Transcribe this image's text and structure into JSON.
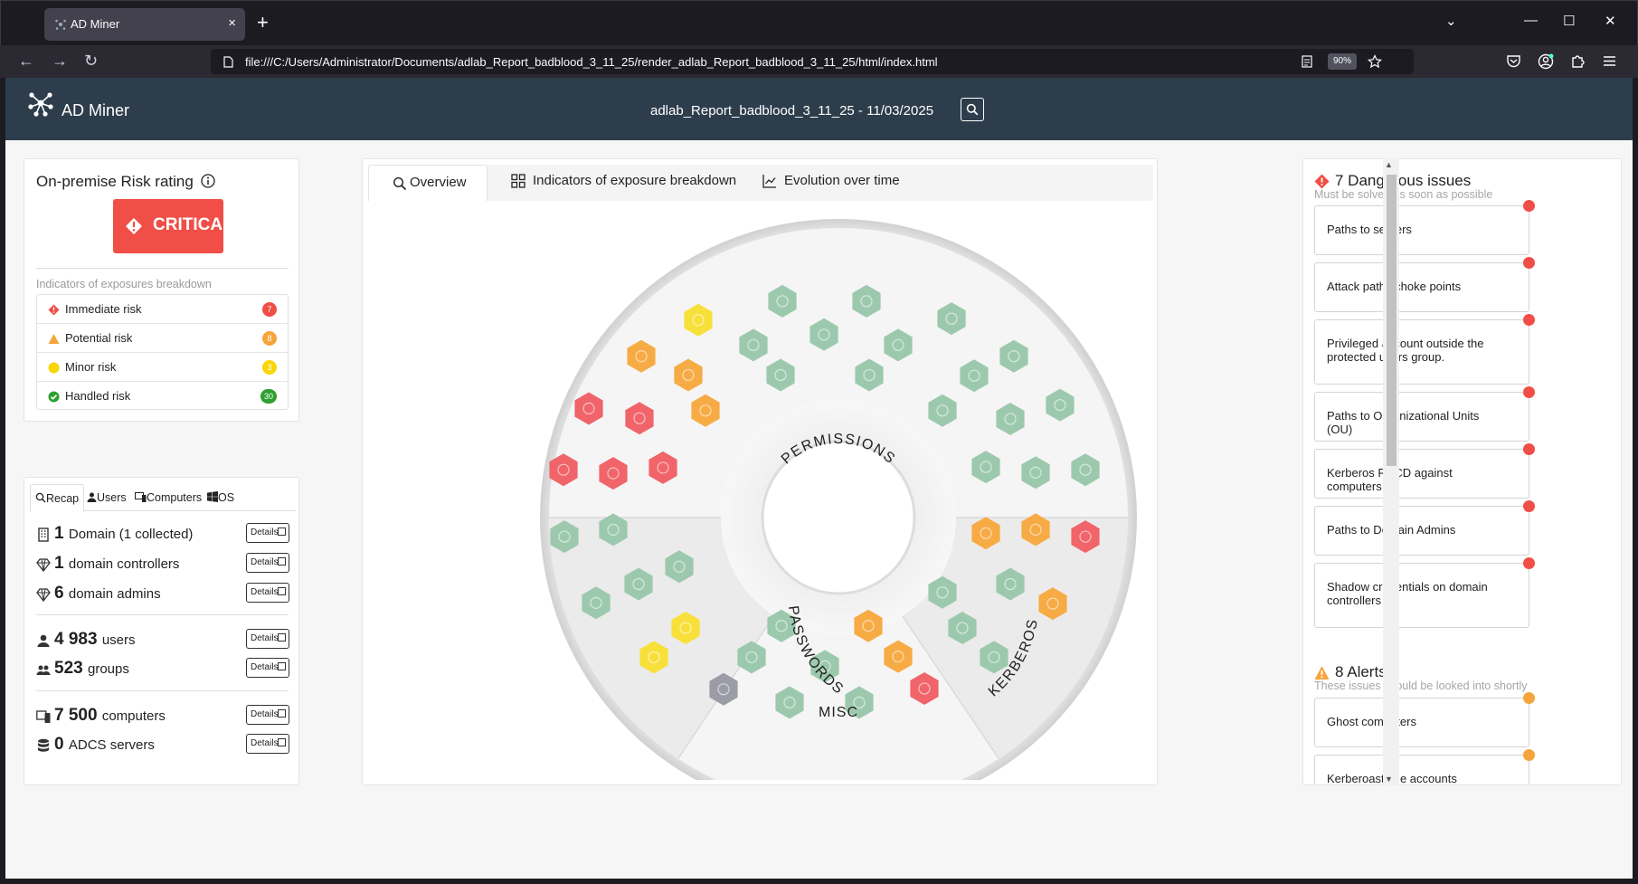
{
  "browser": {
    "tab_title": "AD Miner",
    "tab_close": "×",
    "new_tab": "+",
    "url": "file:///C:/Users/Administrator/Documents/adlab_Report_badblood_3_11_25/render_adlab_Report_badblood_3_11_25/html/index.html",
    "zoom": "90%",
    "controls": {
      "list": "⌄",
      "minimize": "—",
      "maximize": "☐",
      "close": "✕"
    },
    "nav": {
      "back": "←",
      "forward": "→",
      "reload": "↻"
    }
  },
  "header": {
    "brand": "AD Miner",
    "report_title": "adlab_Report_badblood_3_11_25 - 11/03/2025"
  },
  "risk": {
    "title": "On-premise Risk rating",
    "rating": "CRITICAL",
    "rating_color": "#f04e47",
    "indicators_title": "Indicators of exposures breakdown",
    "indicators": [
      {
        "label": "Immediate risk",
        "count": "7",
        "color": "#f04e47",
        "icon": "red-diamond-icon"
      },
      {
        "label": "Potential risk",
        "count": "8",
        "color": "#f5a53c",
        "icon": "orange-triangle-icon"
      },
      {
        "label": "Minor risk",
        "count": "3",
        "color": "#fad50a",
        "icon": "yellow-circle-icon"
      },
      {
        "label": "Handled risk",
        "count": "30",
        "color": "#2fa02f",
        "icon": "green-check-icon"
      }
    ]
  },
  "recap": {
    "tabs": [
      "Recap",
      "Users",
      "Computers",
      "OS"
    ],
    "details_label": "Details",
    "stats": [
      {
        "num": "1",
        "label": "Domain (1 collected)",
        "icon": "building-icon"
      },
      {
        "num": "1",
        "label": "domain controllers",
        "icon": "gem-icon"
      },
      {
        "num": "6",
        "label": "domain admins",
        "icon": "gem-icon"
      },
      {
        "num": "4 983",
        "label": "users",
        "icon": "user-icon"
      },
      {
        "num": "523",
        "label": "groups",
        "icon": "users-icon"
      },
      {
        "num": "7 500",
        "label": "computers",
        "icon": "devices-icon"
      },
      {
        "num": "0",
        "label": "ADCS servers",
        "icon": "database-icon"
      }
    ]
  },
  "overview": {
    "tabs": [
      "Overview",
      "Indicators of exposure breakdown",
      "Evolution over time"
    ],
    "sections": [
      "PERMISSIONS",
      "PASSWORDS",
      "MISC",
      "KERBEROS"
    ]
  },
  "issues": {
    "dangerous": {
      "title": "7 Dangerous issues",
      "subtitle": "Must be solved as soon as possible",
      "color": "#f04e47",
      "items": [
        "Paths to servers",
        "Attack paths choke points",
        "Privileged account outside the protected users group.",
        "Paths to Organizational Units (OU)",
        "Kerberos RBCD against computers",
        "Paths to Domain Admins",
        "Shadow credentials on domain controllers"
      ]
    },
    "alerts": {
      "title": "8 Alerts",
      "subtitle": "These issues should be looked into shortly",
      "color": "#f5a53c",
      "items": [
        "Ghost computers",
        "Kerberoastable accounts",
        ""
      ]
    }
  },
  "colors": {
    "header_bg": "#2e3d4c",
    "red": "#f0646a",
    "orange": "#f7ab45",
    "yellow": "#f8e03a",
    "green": "#9cc9ad",
    "grey": "#9b9ca6"
  }
}
